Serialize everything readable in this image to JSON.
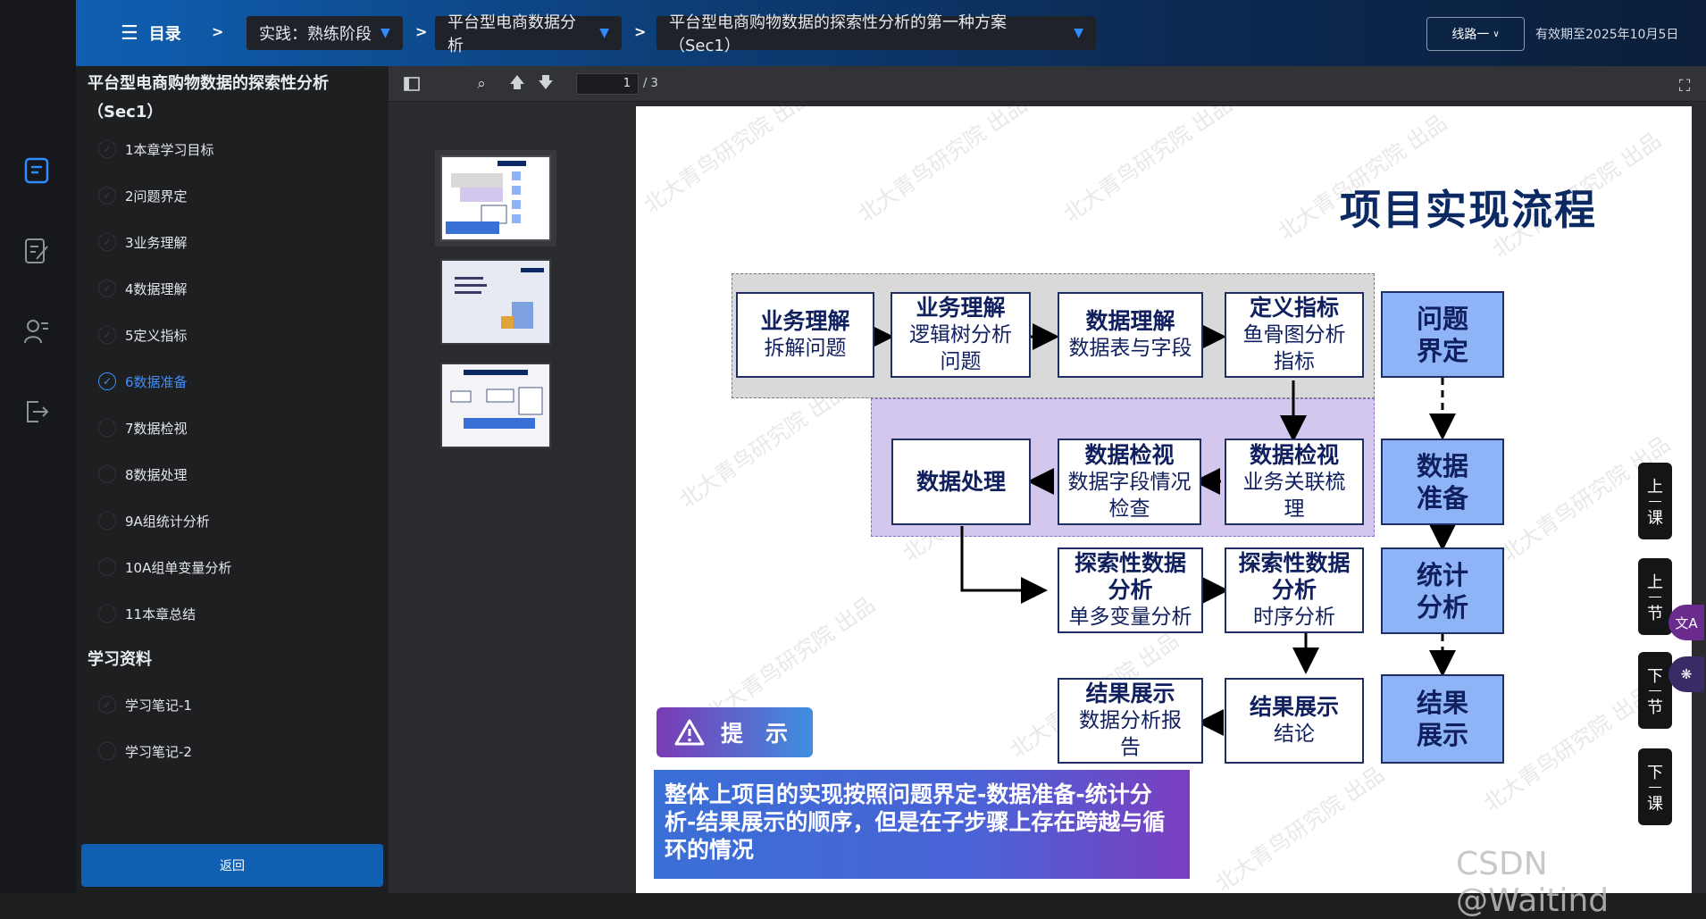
{
  "header": {
    "menu_label": "目录",
    "separator": ">",
    "breadcrumbs": [
      "实践：熟练阶段",
      "平台型电商数据分析",
      "平台型电商购物数据的探索性分析的第一种方案（Sec1）"
    ],
    "route_label": "线路一",
    "valid_until": "有效期至2025年10月5日"
  },
  "sidebar": {
    "title": "平台型电商购物数据的探索性分析（Sec1）",
    "items": [
      {
        "label": "1本章学习目标",
        "active": false
      },
      {
        "label": "2问题界定",
        "active": false
      },
      {
        "label": "3业务理解",
        "active": false
      },
      {
        "label": "4数据理解",
        "active": false
      },
      {
        "label": "5定义指标",
        "active": false
      },
      {
        "label": "6数据准备",
        "active": true
      },
      {
        "label": "7数据检视",
        "active": false
      },
      {
        "label": "8数据处理",
        "active": false
      },
      {
        "label": "9A组统计分析",
        "active": false
      },
      {
        "label": "10A组单变量分析",
        "active": false
      },
      {
        "label": "11本章总结",
        "active": false
      }
    ],
    "materials_title": "学习资料",
    "materials": [
      {
        "label": "学习笔记-1"
      },
      {
        "label": "学习笔记-2"
      }
    ],
    "back_label": "返回"
  },
  "viewer": {
    "page_current": "1",
    "page_total": "/ 3"
  },
  "slide": {
    "title": "项目实现流程",
    "watermark": "北大青鸟研究院 出品",
    "boxes": {
      "biz1": {
        "title": "业务理解",
        "sub": "拆解问题"
      },
      "biz2": {
        "title": "业务理解",
        "sub": "逻辑树分析问题"
      },
      "data_understand": {
        "title": "数据理解",
        "sub": "数据表与字段"
      },
      "define": {
        "title": "定义指标",
        "sub": "鱼骨图分析指标"
      },
      "check2": {
        "title": "数据检视",
        "sub": "业务关联梳理"
      },
      "check1": {
        "title": "数据检视",
        "sub": "数据字段情况检查"
      },
      "process": {
        "title": "数据处理",
        "sub": ""
      },
      "eda1": {
        "title": "探索性数据分析",
        "sub": "单多变量分析"
      },
      "eda2": {
        "title": "探索性数据分析",
        "sub": "时序分析"
      },
      "result2": {
        "title": "结果展示",
        "sub": "结论"
      },
      "result1": {
        "title": "结果展示",
        "sub": "数据分析报告"
      }
    },
    "steps": [
      "问题界定",
      "数据准备",
      "统计分析",
      "结果展示"
    ],
    "hint_label": "提　示",
    "hint_text": "整体上项目的实现按照问题界定-数据准备-统计分析-结果展示的顺序，但是在子步骤上存在跨越与循环的情况"
  },
  "right_nav": {
    "prev_lesson": [
      "上",
      "课"
    ],
    "prev_section": [
      "上",
      "节"
    ],
    "next_section": [
      "下",
      "节"
    ],
    "next_lesson": [
      "下",
      "课"
    ]
  },
  "footer_watermark": "CSDN @Waitind"
}
